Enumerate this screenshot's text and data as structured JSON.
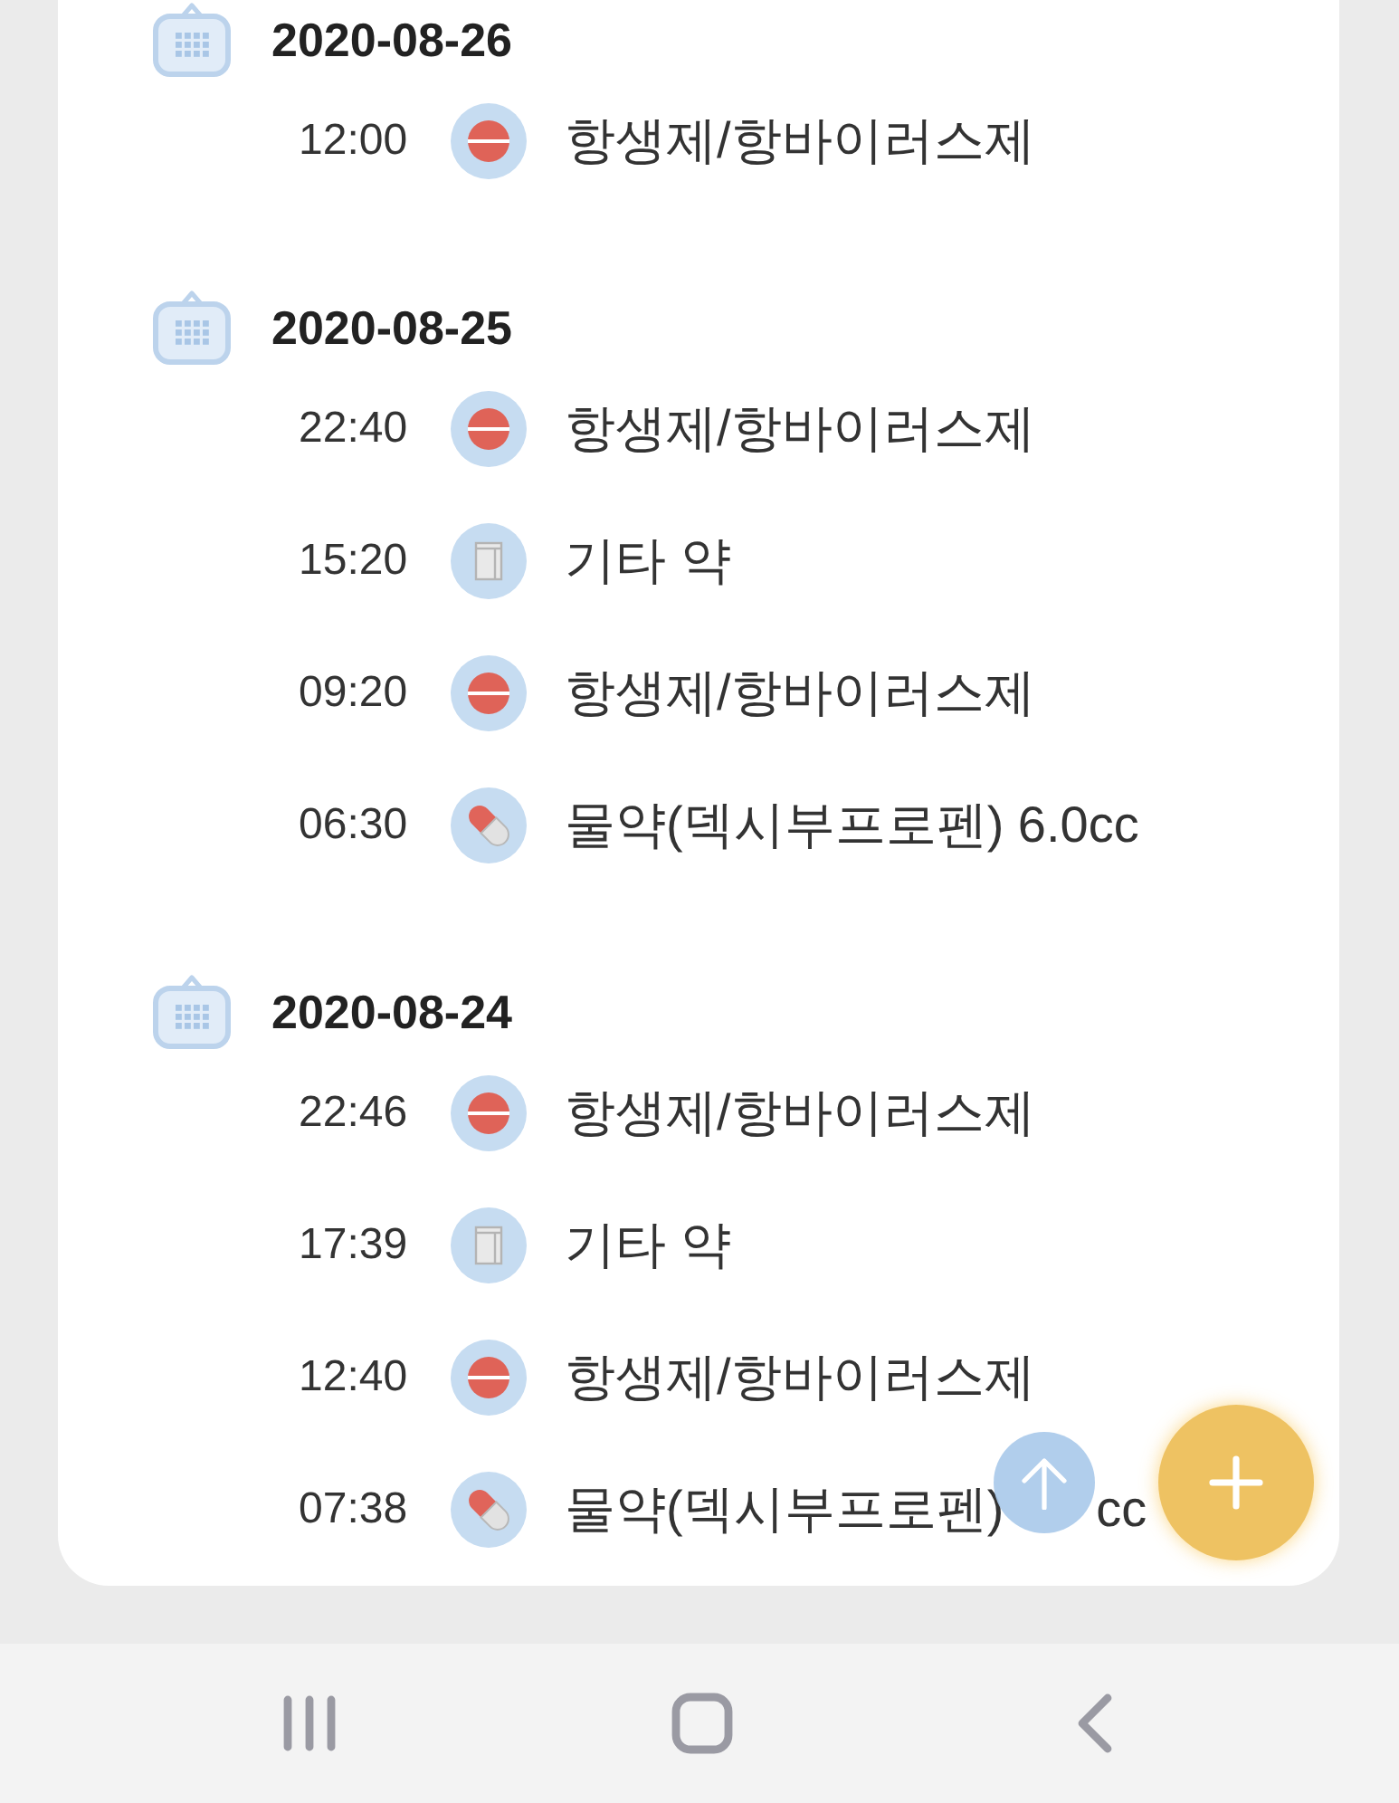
{
  "groups": [
    {
      "date": "2020-08-26",
      "entries": [
        {
          "time": "12:00",
          "kind": "antibiotic",
          "label": "항생제/항바이러스제"
        }
      ]
    },
    {
      "date": "2020-08-25",
      "entries": [
        {
          "time": "22:40",
          "kind": "antibiotic",
          "label": "항생제/항바이러스제"
        },
        {
          "time": "15:20",
          "kind": "other",
          "label": "기타 약"
        },
        {
          "time": "09:20",
          "kind": "antibiotic",
          "label": "항생제/항바이러스제"
        },
        {
          "time": "06:30",
          "kind": "syrup",
          "label": "물약(덱시부프로펜) 6.0cc"
        }
      ]
    },
    {
      "date": "2020-08-24",
      "entries": [
        {
          "time": "22:46",
          "kind": "antibiotic",
          "label": "항생제/항바이러스제"
        },
        {
          "time": "17:39",
          "kind": "other",
          "label": "기타 약"
        },
        {
          "time": "12:40",
          "kind": "antibiotic",
          "label": "항생제/항바이러스제"
        },
        {
          "time": "07:38",
          "kind": "syrup",
          "label": "물약(덱시부프로펜)",
          "label_tail": "cc"
        }
      ]
    }
  ]
}
